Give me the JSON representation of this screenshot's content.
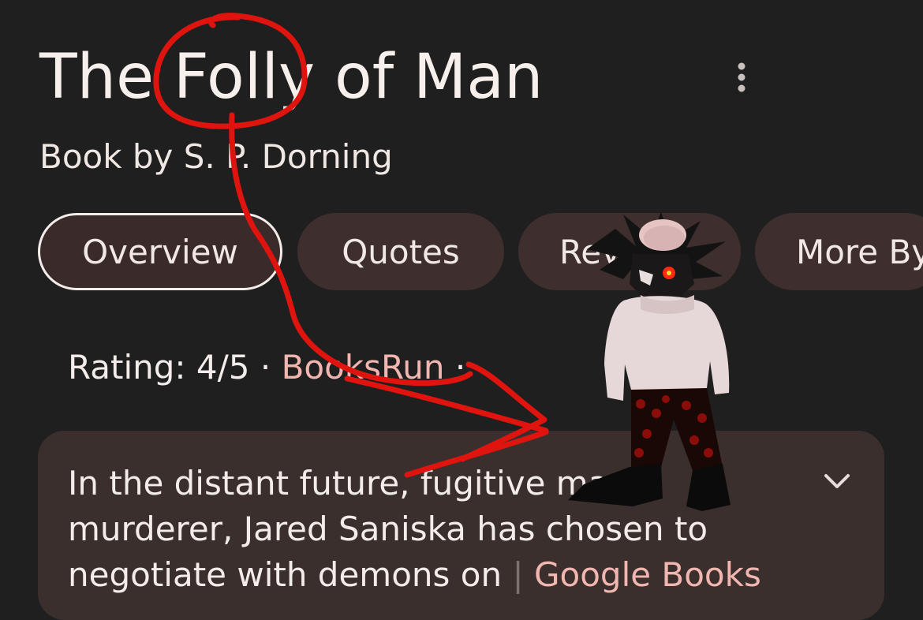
{
  "header": {
    "title": "The Folly of Man",
    "subtitle": "Book by S. P. Dorning",
    "menu_icon": "more-vert-icon"
  },
  "tabs": [
    {
      "label": "Overview",
      "active": true
    },
    {
      "label": "Quotes",
      "active": false
    },
    {
      "label": "Rev",
      "active": false
    },
    {
      "label": "More By",
      "active": false
    }
  ],
  "rating": {
    "label": "Rating: 4/5",
    "separator": "·",
    "source": "BooksRun",
    "trailing": "·"
  },
  "description": {
    "line1": "In the distant future, fugitive mass",
    "line2": "murderer, Jared Saniska has chosen to",
    "line3": "negotiate with demons on",
    "source": "Google Books",
    "expand_icon": "chevron-down-icon"
  },
  "colors": {
    "background": "#201f1f",
    "chip": "#3e2f2e",
    "accent_link": "#f2b6b0",
    "annotation": "#e0140f"
  }
}
